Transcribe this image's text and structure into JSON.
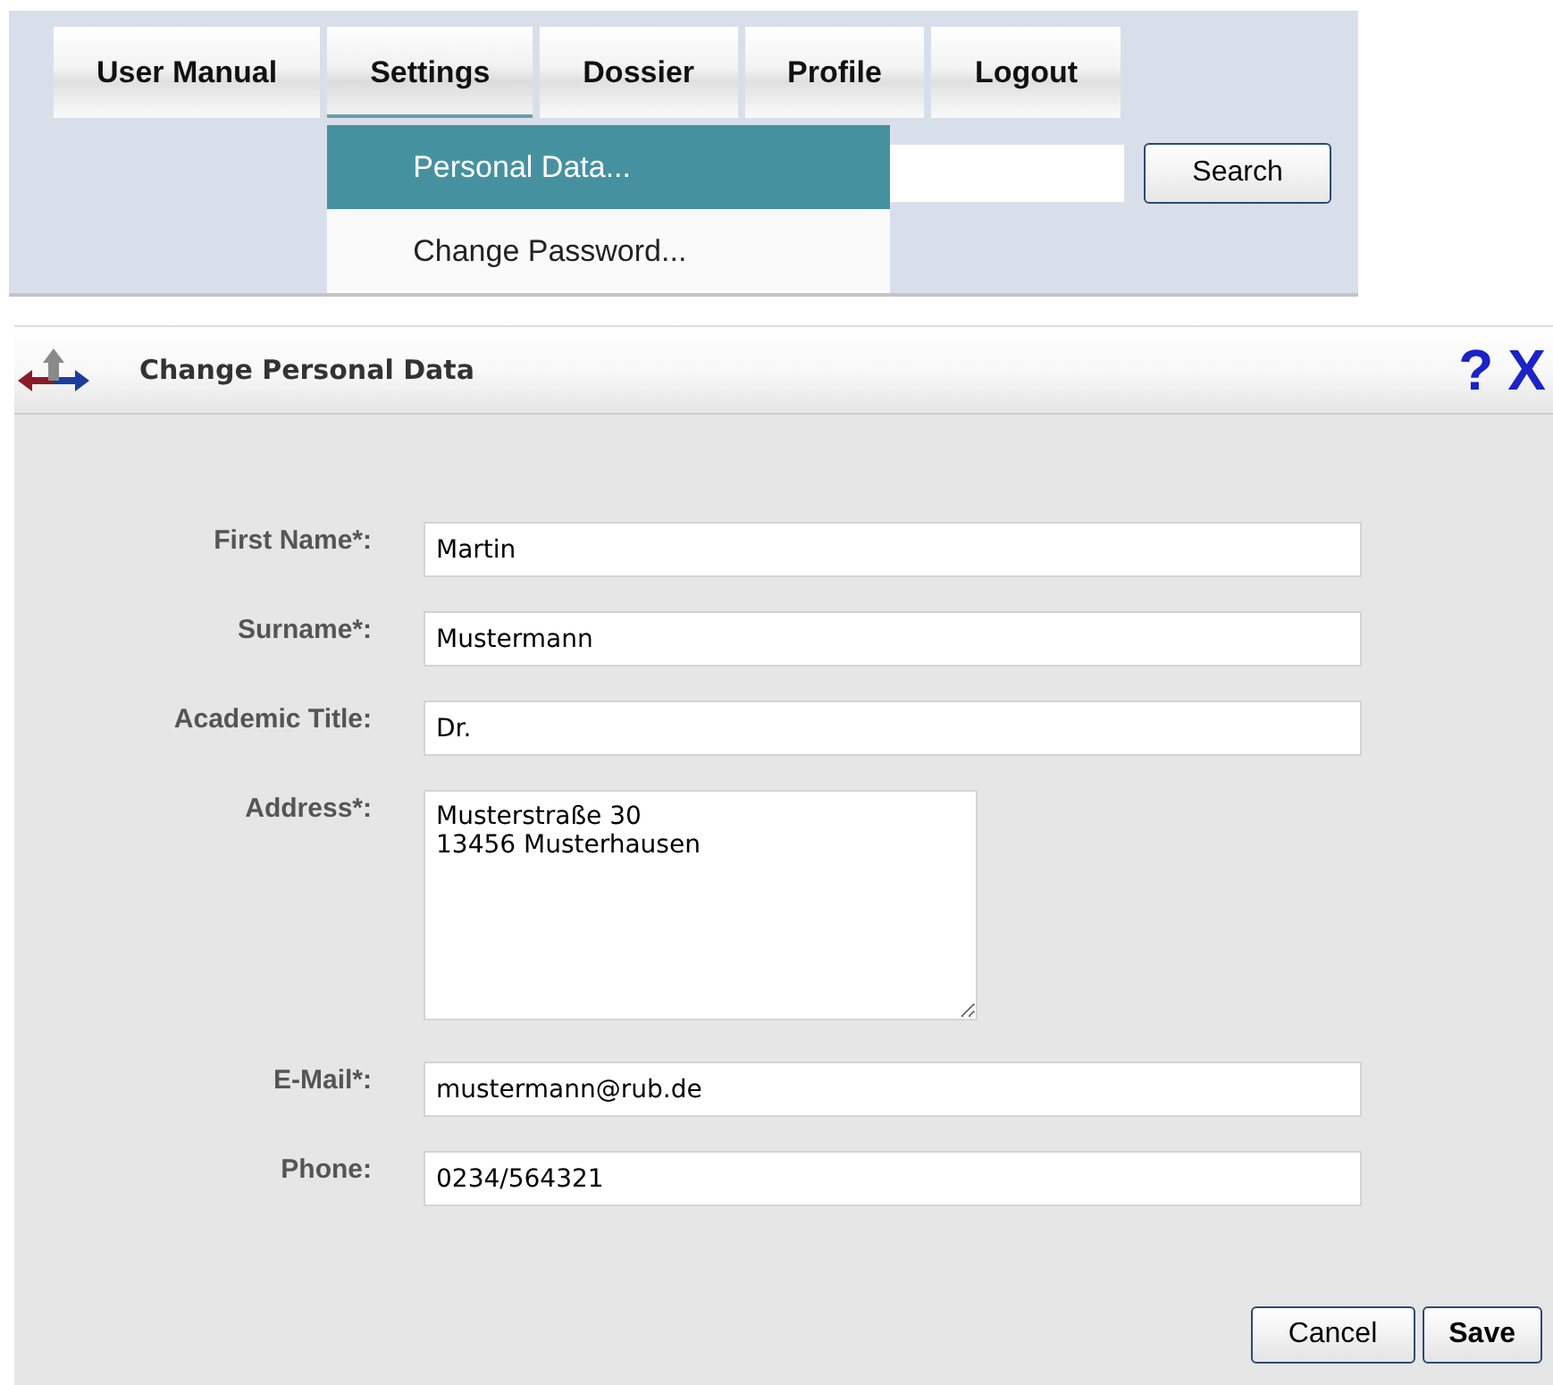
{
  "menu": [
    {
      "label": "User Manual",
      "expanded": false
    },
    {
      "label": "Settings",
      "expanded": true,
      "dropdown": [
        {
          "label": "Personal Data...",
          "selected": true
        },
        {
          "label": "Change Password...",
          "selected": false
        }
      ]
    },
    {
      "label": "Dossier",
      "expanded": false
    },
    {
      "label": "Profile",
      "expanded": false
    },
    {
      "label": "Logout",
      "expanded": false
    }
  ],
  "search": {
    "button": "Search"
  },
  "dialog": {
    "title": "Change Personal Data",
    "help": "?",
    "close": "X",
    "fields": [
      {
        "kind": "line",
        "label": "First Name*:",
        "value": "Martin"
      },
      {
        "kind": "line",
        "label": "Surname*:",
        "value": "Mustermann"
      },
      {
        "kind": "line",
        "label": "Academic Title:",
        "value": "Dr."
      },
      {
        "kind": "area",
        "label": "Address*:",
        "value": "Musterstraße 30\n13456 Musterhausen"
      },
      {
        "kind": "line",
        "label": "E-Mail*:",
        "value": "mustermann@rub.de"
      },
      {
        "kind": "line",
        "label": "Phone:",
        "value": "0234/564321"
      }
    ],
    "buttons": [
      {
        "label": "Cancel",
        "primary": false
      },
      {
        "label": "Save",
        "primary": true
      }
    ]
  }
}
